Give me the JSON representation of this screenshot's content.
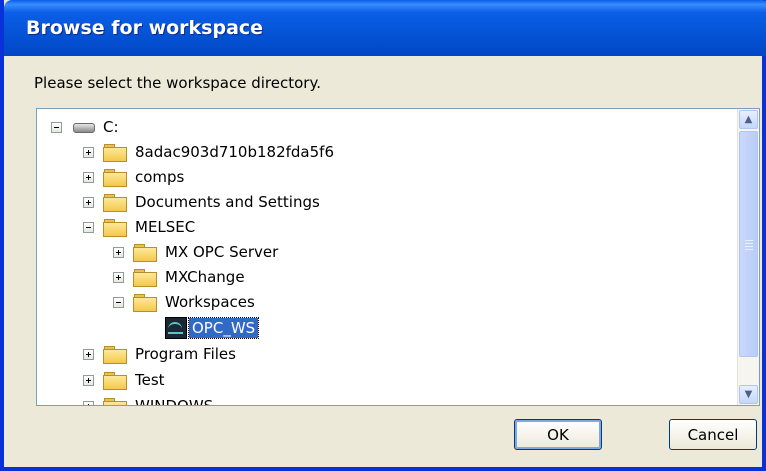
{
  "window": {
    "title": "Browse for workspace"
  },
  "prompt": "Please select the workspace directory.",
  "tree": {
    "nodes": [
      {
        "label": "C:",
        "icon": "drive-icon",
        "expander": "minus"
      },
      {
        "label": "8adac903d710b182fda5f6",
        "icon": "folder-icon",
        "expander": "plus"
      },
      {
        "label": "comps",
        "icon": "folder-icon",
        "expander": "plus"
      },
      {
        "label": "Documents and Settings",
        "icon": "folder-icon",
        "expander": "plus"
      },
      {
        "label": "MELSEC",
        "icon": "folder-icon",
        "expander": "minus"
      },
      {
        "label": "MX OPC Server",
        "icon": "folder-icon",
        "expander": "plus"
      },
      {
        "label": "MXChange",
        "icon": "folder-icon",
        "expander": "plus"
      },
      {
        "label": "Workspaces",
        "icon": "folder-icon",
        "expander": "minus"
      },
      {
        "label": "OPC_WS",
        "icon": "workspace-icon",
        "expander": "none",
        "selected": true
      },
      {
        "label": "Program Files",
        "icon": "folder-icon",
        "expander": "plus"
      },
      {
        "label": "Test",
        "icon": "folder-icon",
        "expander": "plus"
      },
      {
        "label": "WINDOWS",
        "icon": "folder-icon",
        "expander": "plus"
      }
    ]
  },
  "buttons": {
    "ok": "OK",
    "cancel": "Cancel"
  },
  "colors": {
    "title_bar": "#0553d6",
    "selection": "#316ac5",
    "dialog_bg": "#ece9d8"
  }
}
